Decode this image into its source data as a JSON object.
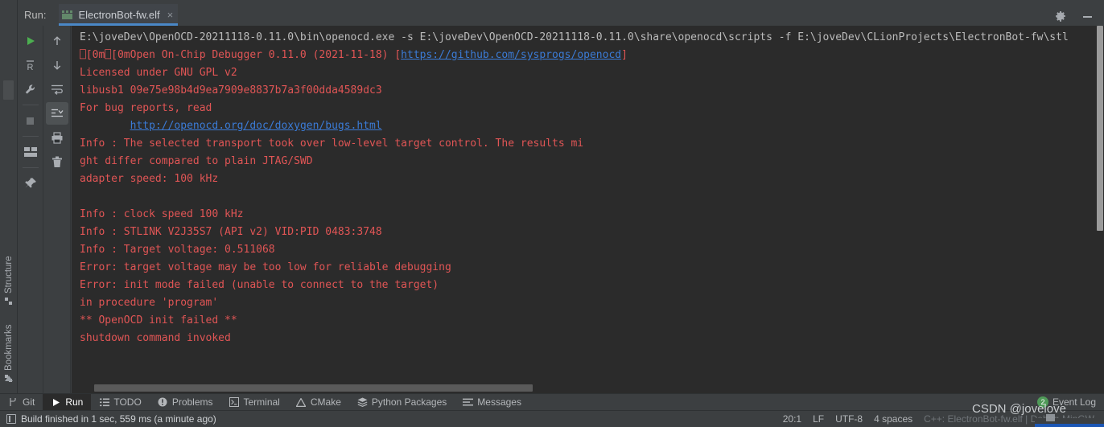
{
  "window": {
    "run_label": "Run:",
    "tab_title": "ElectronBot-fw.elf",
    "tab_close": "×",
    "gear_icon": "gear-icon",
    "minimize_icon": "minimize-icon"
  },
  "left_strip": {
    "structure_label": "Structure",
    "bookmarks_label": "Bookmarks"
  },
  "run_toolbar": {
    "col1": [
      {
        "name": "rerun-button",
        "icon": "play-green-icon"
      },
      {
        "name": "rerun-failed-tests-button",
        "icon": "r-letter-icon"
      },
      {
        "name": "edit-configuration-button",
        "icon": "wrench-icon"
      },
      {
        "name": "stop-button",
        "icon": "stop-square-icon"
      },
      {
        "name": "layout-button",
        "icon": "layout-icon"
      },
      {
        "name": "pin-tab-button",
        "icon": "pin-icon"
      }
    ],
    "col2": [
      {
        "name": "up-button",
        "icon": "arrow-up-icon"
      },
      {
        "name": "down-button",
        "icon": "arrow-down-icon"
      },
      {
        "name": "soft-wrap-button",
        "icon": "soft-wrap-icon"
      },
      {
        "name": "scroll-to-end-button",
        "icon": "scroll-to-end-icon"
      },
      {
        "name": "print-button",
        "icon": "printer-icon"
      },
      {
        "name": "clear-all-button",
        "icon": "trash-icon"
      }
    ]
  },
  "console": {
    "lines": [
      {
        "id": "cmd",
        "parts": [
          {
            "text": "E:\\joveDev\\OpenOCD-20211118-0.11.0\\bin\\openocd.exe -s E:\\joveDev\\OpenOCD-20211118-0.11.0\\share\\openocd\\scripts -f E:\\joveDev\\CLionProjects\\ElectronBot-fw\\stl",
            "style": "cmd"
          }
        ]
      },
      {
        "id": "banner",
        "parts": [
          {
            "text": "⎕[0m⎕[0mOpen On-Chip Debugger 0.11.0 (2021-11-18) [",
            "style": "err"
          },
          {
            "text": "https://github.com/sysprogs/openocd",
            "style": "link"
          },
          {
            "text": "]",
            "style": "err"
          }
        ]
      },
      {
        "id": "license",
        "parts": [
          {
            "text": "Licensed under GNU GPL v2",
            "style": "err"
          }
        ]
      },
      {
        "id": "libusb",
        "parts": [
          {
            "text": "libusb1 09e75e98b4d9ea7909e8837b7a3f00dda4589dc3",
            "style": "err"
          }
        ]
      },
      {
        "id": "bugreports",
        "parts": [
          {
            "text": "For bug reports, read",
            "style": "err"
          }
        ]
      },
      {
        "id": "bugurl",
        "parts": [
          {
            "text": "        ",
            "style": "err"
          },
          {
            "text": "http://openocd.org/doc/doxygen/bugs.html",
            "style": "link"
          }
        ]
      },
      {
        "id": "transport1",
        "parts": [
          {
            "text": "Info : The selected transport took over low-level target control. The results mi",
            "style": "err"
          }
        ]
      },
      {
        "id": "transport2",
        "parts": [
          {
            "text": "ght differ compared to plain JTAG/SWD",
            "style": "err"
          }
        ]
      },
      {
        "id": "adapterspeed",
        "parts": [
          {
            "text": "adapter speed: 100 kHz",
            "style": "err"
          }
        ]
      },
      {
        "id": "blank1",
        "parts": [
          {
            "text": " ",
            "style": "err"
          }
        ]
      },
      {
        "id": "clockspeed",
        "parts": [
          {
            "text": "Info : clock speed 100 kHz",
            "style": "err"
          }
        ]
      },
      {
        "id": "stlink",
        "parts": [
          {
            "text": "Info : STLINK V2J35S7 (API v2) VID:PID 0483:3748",
            "style": "err"
          }
        ]
      },
      {
        "id": "voltage",
        "parts": [
          {
            "text": "Info : Target voltage: 0.511068",
            "style": "err"
          }
        ]
      },
      {
        "id": "err_voltage",
        "parts": [
          {
            "text": "Error: target voltage may be too low for reliable debugging",
            "style": "err"
          }
        ]
      },
      {
        "id": "err_init",
        "parts": [
          {
            "text": "Error: init mode failed (unable to connect to the target)",
            "style": "err"
          }
        ]
      },
      {
        "id": "procedure",
        "parts": [
          {
            "text": "in procedure 'program'",
            "style": "err"
          }
        ]
      },
      {
        "id": "initfailed",
        "parts": [
          {
            "text": "** OpenOCD init failed **",
            "style": "err"
          }
        ]
      },
      {
        "id": "shutdown",
        "parts": [
          {
            "text": "shutdown command invoked",
            "style": "err"
          }
        ]
      }
    ]
  },
  "bottom_bar": {
    "items": [
      {
        "name": "bottom-tab-git",
        "label": "Git",
        "icon": "git-branch-icon",
        "active": false
      },
      {
        "name": "bottom-tab-run",
        "label": "Run",
        "icon": "play-icon",
        "active": true
      },
      {
        "name": "bottom-tab-todo",
        "label": "TODO",
        "icon": "list-icon",
        "active": false
      },
      {
        "name": "bottom-tab-problems",
        "label": "Problems",
        "icon": "error-circle-icon",
        "active": false
      },
      {
        "name": "bottom-tab-terminal",
        "label": "Terminal",
        "icon": "terminal-icon",
        "active": false
      },
      {
        "name": "bottom-tab-cmake",
        "label": "CMake",
        "icon": "triangle-warning-icon",
        "active": false
      },
      {
        "name": "bottom-tab-python-packages",
        "label": "Python Packages",
        "icon": "stack-icon",
        "active": false
      },
      {
        "name": "bottom-tab-messages",
        "label": "Messages",
        "icon": "messages-icon",
        "active": false
      }
    ],
    "event_log": {
      "label": "Event Log",
      "count": "2"
    }
  },
  "status_bar": {
    "message": "Build finished in 1 sec, 559 ms (a minute ago)",
    "caret": "20:1",
    "line_separator": "LF",
    "encoding": "UTF-8",
    "indent": "4 spaces",
    "config": "C++: ElectronBot-fw.elf | Debug-MinGW"
  },
  "watermark": {
    "text": "CSDN @jovelove"
  },
  "colors": {
    "panel_bg": "#3c3f41",
    "console_bg": "#2b2b2b",
    "error_red": "#e05555",
    "link_blue": "#3b7bd6",
    "tab_underline": "#4a88c7",
    "accent_blue": "#1b56b5",
    "badge_green": "#4f9a58"
  }
}
